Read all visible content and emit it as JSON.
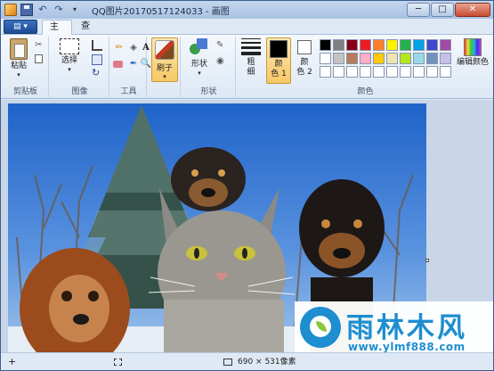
{
  "window": {
    "title": "QQ图片20170517124033 - 画图",
    "minimize": "─",
    "maximize": "□",
    "close": "✕"
  },
  "quick_access": {
    "undo": "↶",
    "redo": "↷",
    "more": "▾"
  },
  "menu": {
    "file_label": "▤ ▾"
  },
  "tabs": [
    {
      "label": "主页"
    },
    {
      "label": "查看"
    }
  ],
  "ribbon": {
    "clipboard": {
      "paste": "粘贴",
      "group": "剪贴板",
      "cut": "✂"
    },
    "image": {
      "select": "选择",
      "group": "图像",
      "rotate": "↻"
    },
    "tools": {
      "group": "工具",
      "pencil": "✏",
      "fill": "◈",
      "text": "A",
      "picker": "✒",
      "magnifier": "🔍"
    },
    "brush": {
      "label": "刷子"
    },
    "shapes": {
      "label": "形状",
      "group": "形状",
      "outline": "✎",
      "fill": "◉"
    },
    "colors": {
      "size_line1": "粗",
      "size_line2": "细",
      "color1_line1": "颜",
      "color1_line2": "色 1",
      "color2_line1": "颜",
      "color2_line2": "色 2",
      "edit": "编辑颜色",
      "group": "颜色",
      "palette": [
        "#000000",
        "#7f7f7f",
        "#880015",
        "#ed1c24",
        "#ff7f27",
        "#fff200",
        "#22b14c",
        "#00a2e8",
        "#3f48cc",
        "#a349a4",
        "#ffffff",
        "#c3c3c3",
        "#b97a57",
        "#ffaec9",
        "#ffc90e",
        "#efe4b0",
        "#b5e61d",
        "#99d9ea",
        "#7092be",
        "#c8bfe7",
        "#ffffff",
        "#ffffff",
        "#ffffff",
        "#ffffff",
        "#ffffff",
        "#ffffff",
        "#ffffff",
        "#ffffff",
        "#ffffff",
        "#ffffff"
      ],
      "color1": "#000000",
      "color2": "#ffffff"
    }
  },
  "watermark": {
    "title": "雨林木风",
    "url": "www.ylmf888.com"
  },
  "status": {
    "add": "+",
    "dimensions": "690 × 531像素"
  }
}
